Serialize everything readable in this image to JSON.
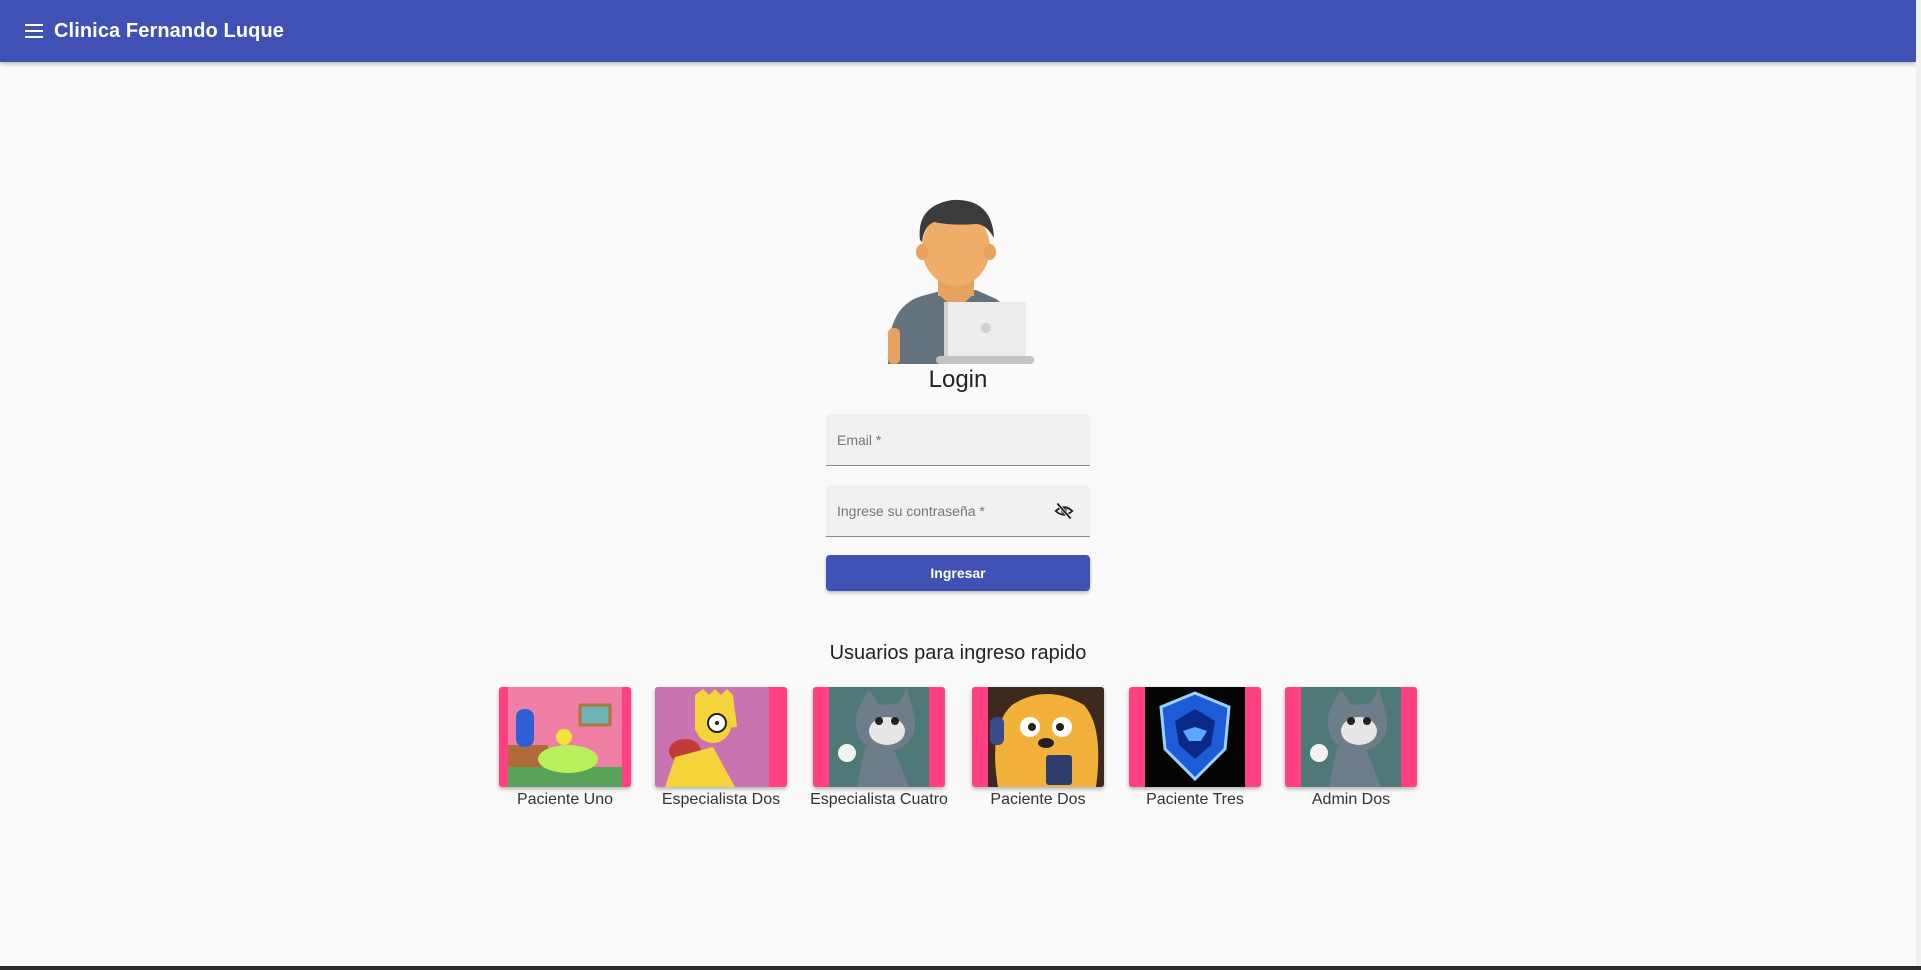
{
  "header": {
    "title": "Clinica Fernando Luque",
    "menu_icon": "menu-icon",
    "color": "#3f51b5"
  },
  "login": {
    "avatar_icon": "user-laptop-avatar-icon",
    "title": "Login",
    "email_placeholder": "Email *",
    "email_value": "",
    "password_placeholder": "Ingrese su contraseña *",
    "password_value": "",
    "toggle_visibility_icon": "visibility-off-icon",
    "submit_label": "Ingresar"
  },
  "quick_access": {
    "title": "Usuarios para ingreso rapido",
    "accent": "#ff4081",
    "users": [
      {
        "name": "Paciente Uno",
        "image": "cartoon-woman-image"
      },
      {
        "name": "Especialista Dos",
        "image": "cartoon-boy-image"
      },
      {
        "name": "Especialista Cuatro",
        "image": "cartoon-cat-image"
      },
      {
        "name": "Paciente Dos",
        "image": "cartoon-dog-headphones-image"
      },
      {
        "name": "Paciente Tres",
        "image": "blue-mascot-logo-image"
      },
      {
        "name": "Admin Dos",
        "image": "cartoon-cat-image"
      }
    ]
  }
}
